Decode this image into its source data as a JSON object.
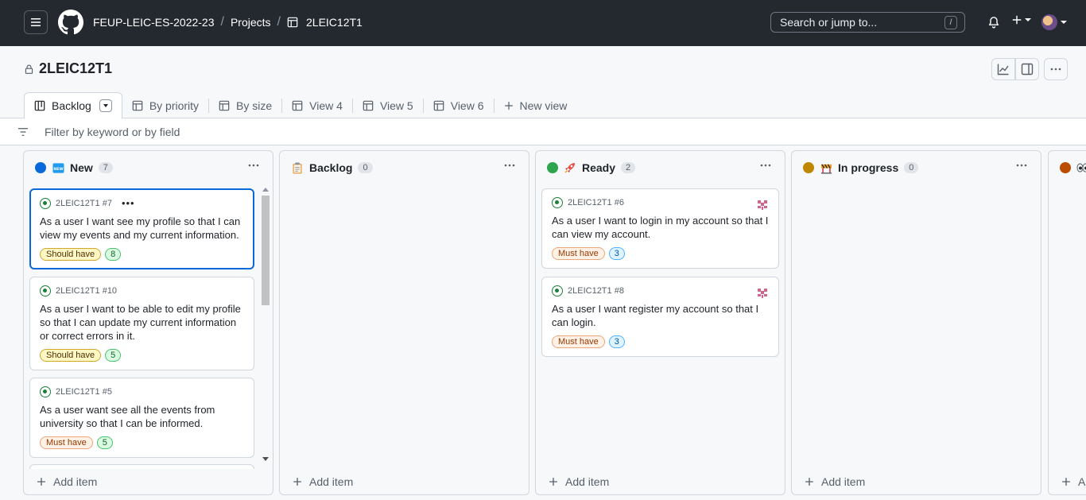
{
  "header": {
    "breadcrumbs": [
      "FEUP-LEIC-ES-2022-23",
      "Projects",
      "2LEIC12T1"
    ],
    "search_placeholder": "Search or jump to...",
    "search_shortcut": "/"
  },
  "project": {
    "title": "2LEIC12T1",
    "tabs": [
      {
        "label": "Backlog",
        "active": true
      },
      {
        "label": "By priority"
      },
      {
        "label": "By size"
      },
      {
        "label": "View 4"
      },
      {
        "label": "View 5"
      },
      {
        "label": "View 6"
      },
      {
        "label": "New view"
      }
    ],
    "filter_placeholder": "Filter by keyword or by field"
  },
  "columns": [
    {
      "name": "New",
      "count": "7",
      "dot_color": "#0969da",
      "emoji": "new-badge",
      "add_label": "Add item",
      "cards": [
        {
          "ref": "2LEIC12T1 #7",
          "title": "As a user I want see my profile so that I can view my events and my current information.",
          "priority": "Should have",
          "size": "8"
        },
        {
          "ref": "2LEIC12T1 #10",
          "title": "As a user I want to be able to edit my profile so that I can update my current information or correct errors in it.",
          "priority": "Should have",
          "size": "5"
        },
        {
          "ref": "2LEIC12T1 #5",
          "title": "As a user want see all the events from university so that I can be informed.",
          "priority": "Must have",
          "size": "5"
        }
      ]
    },
    {
      "name": "Backlog",
      "count": "0",
      "emoji": "clipboard",
      "add_label": "Add item",
      "cards": []
    },
    {
      "name": "Ready",
      "count": "2",
      "dot_color": "#2da44e",
      "emoji": "rocket",
      "add_label": "Add item",
      "cards": [
        {
          "ref": "2LEIC12T1 #6",
          "title": "As a user I want to login in my account so that I can view my account.",
          "priority": "Must have",
          "size": "3"
        },
        {
          "ref": "2LEIC12T1 #8",
          "title": "As a user I want register my account so that I can login.",
          "priority": "Must have",
          "size": "3"
        }
      ]
    },
    {
      "name": "In progress",
      "count": "0",
      "dot_color": "#bf8700",
      "emoji": "construction",
      "add_label": "Add item",
      "cards": []
    },
    {
      "name": "",
      "count": "",
      "dot_color": "#bc4c00",
      "emoji": "eyes",
      "add_label": "Ad",
      "cards": []
    }
  ]
}
